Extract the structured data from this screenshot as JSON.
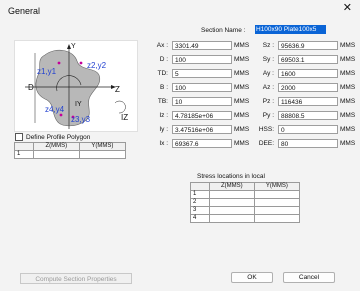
{
  "window": {
    "title": "General",
    "close_glyph": "✕"
  },
  "section": {
    "label": "Section Name :",
    "value": "H100x90 Plate100x5"
  },
  "diagram": {
    "labels": {
      "y": "Y",
      "z": "Z",
      "d": "D",
      "iy": "IY",
      "iz": "IZ",
      "z1y1": "z1,y1",
      "z2y2": "z2,y2",
      "z3y3": "z3,y3",
      "z4y4": "z4,y4"
    }
  },
  "define_polygon": {
    "label": "Define Profile Polygon",
    "checked": false
  },
  "polygon_table": {
    "headers": [
      "",
      "Z(MMS)",
      "Y(MMS)"
    ],
    "rows": [
      [
        "1",
        "",
        ""
      ]
    ]
  },
  "props_left": [
    {
      "label": "Ax :",
      "value": "3301.49",
      "unit": "MMS"
    },
    {
      "label": "D :",
      "value": "100",
      "unit": "MMS"
    },
    {
      "label": "TD:",
      "value": "5",
      "unit": "MMS"
    },
    {
      "label": "B :",
      "value": "100",
      "unit": "MMS"
    },
    {
      "label": "TB:",
      "value": "10",
      "unit": "MMS"
    },
    {
      "label": "Iz :",
      "value": "4.78185e+06",
      "unit": "MMS"
    },
    {
      "label": "Iy :",
      "value": "3.47516e+06",
      "unit": "MMS"
    },
    {
      "label": "Ix :",
      "value": "69367.6",
      "unit": "MMS"
    }
  ],
  "props_right": [
    {
      "label": "Sz :",
      "value": "95636.9",
      "unit": "MMS"
    },
    {
      "label": "Sy :",
      "value": "69503.1",
      "unit": "MMS"
    },
    {
      "label": "Ay :",
      "value": "1600",
      "unit": "MMS"
    },
    {
      "label": "Az :",
      "value": "2000",
      "unit": "MMS"
    },
    {
      "label": "Pz :",
      "value": "116436",
      "unit": "MMS"
    },
    {
      "label": "Py :",
      "value": "88808.5",
      "unit": "MMS"
    },
    {
      "label": "HSS:",
      "value": "0",
      "unit": "MMS"
    },
    {
      "label": "DEE:",
      "value": "80",
      "unit": "MMS"
    }
  ],
  "stress": {
    "title": "Stress locations in local",
    "headers": [
      "",
      "Z(MMS)",
      "Y(MMS)"
    ],
    "rows": [
      [
        "1",
        "",
        ""
      ],
      [
        "2",
        "",
        ""
      ],
      [
        "3",
        "",
        ""
      ],
      [
        "4",
        "",
        ""
      ]
    ]
  },
  "buttons": {
    "compute": "Compute Section Properties",
    "ok": "OK",
    "cancel": "Cancel"
  }
}
